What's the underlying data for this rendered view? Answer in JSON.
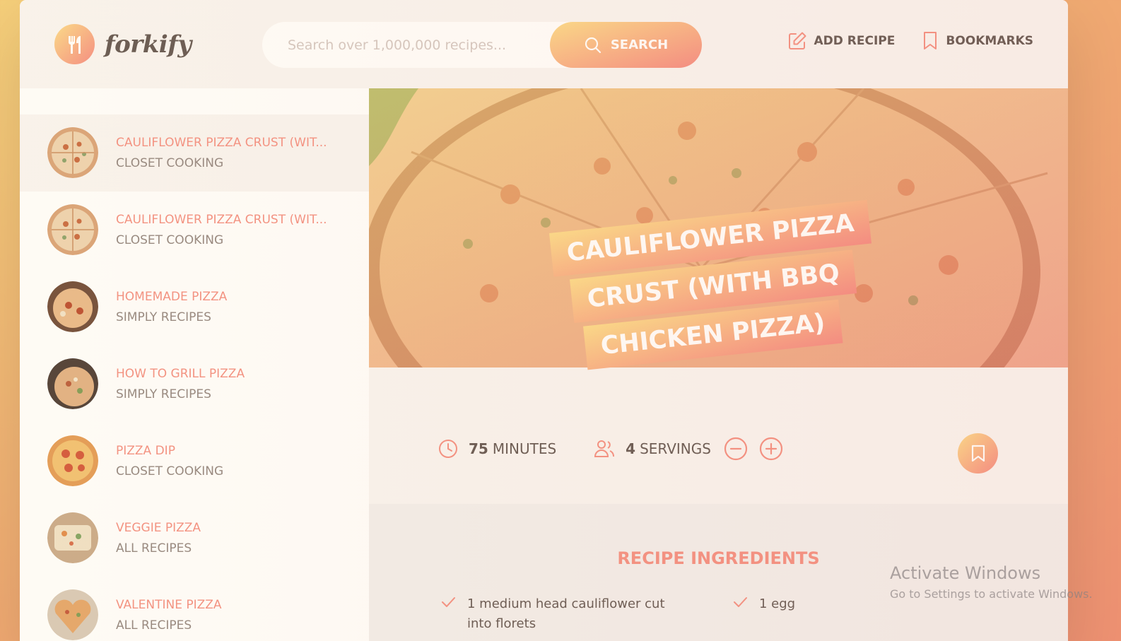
{
  "header": {
    "logo_text": "forkify",
    "search_placeholder": "Search over 1,000,000 recipes...",
    "search_button": "SEARCH",
    "nav": [
      {
        "label": "ADD RECIPE",
        "icon": "edit-icon"
      },
      {
        "label": "BOOKMARKS",
        "icon": "bookmark-icon"
      }
    ]
  },
  "results": [
    {
      "title": "CAULIFLOWER PIZZA CRUST (WIT...",
      "publisher": "CLOSET COOKING",
      "active": true
    },
    {
      "title": "CAULIFLOWER PIZZA CRUST (WIT...",
      "publisher": "CLOSET COOKING"
    },
    {
      "title": "HOMEMADE PIZZA",
      "publisher": "SIMPLY RECIPES"
    },
    {
      "title": "HOW TO GRILL PIZZA",
      "publisher": "SIMPLY RECIPES"
    },
    {
      "title": "PIZZA DIP",
      "publisher": "CLOSET COOKING"
    },
    {
      "title": "VEGGIE PIZZA",
      "publisher": "ALL RECIPES"
    },
    {
      "title": "VALENTINE PIZZA",
      "publisher": "ALL RECIPES"
    }
  ],
  "recipe": {
    "title_lines": [
      "CAULIFLOWER PIZZA",
      "CRUST (WITH BBQ",
      "CHICKEN PIZZA)"
    ],
    "minutes_value": "75",
    "minutes_label": "MINUTES",
    "servings_value": "4",
    "servings_label": "SERVINGS",
    "ingredients_heading": "RECIPE INGREDIENTS",
    "ingredients": [
      "1 medium head cauliflower cut into florets",
      "1 egg"
    ]
  },
  "system_overlay": {
    "line1": "Activate Windows",
    "line2": "Go to Settings to activate Windows."
  },
  "colors": {
    "accent": "#f38e82",
    "gradient_start": "#fbdb89",
    "gradient_end": "#f48982",
    "text": "#615551",
    "muted": "#918581",
    "background_light": "#f9f5f3"
  }
}
